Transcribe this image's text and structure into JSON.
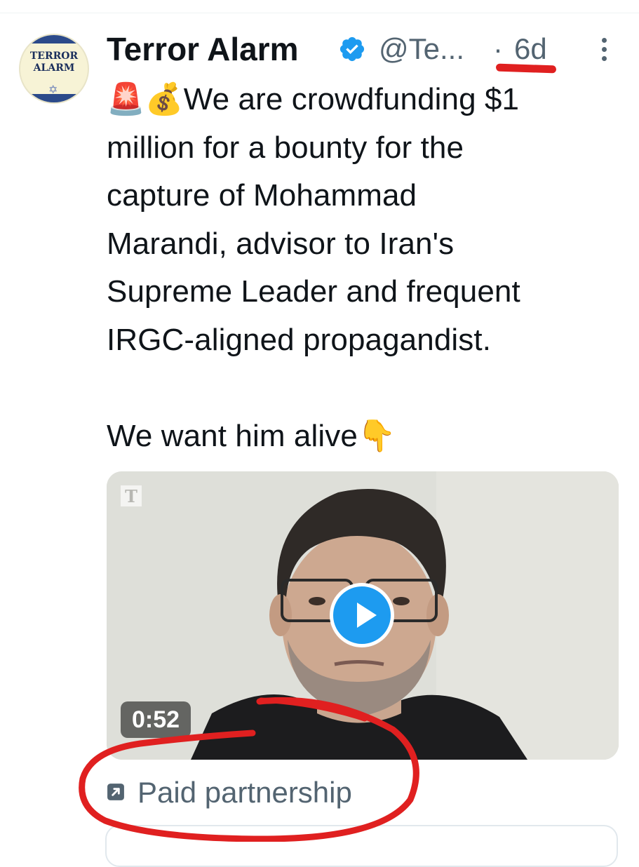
{
  "author": {
    "name": "Terror Alarm",
    "handle": "@Te...",
    "separator": "·",
    "time": "6d",
    "avatar_text_line1": "TERROR",
    "avatar_text_line2": "ALARM",
    "verified_icon": "verified-badge-icon",
    "more_icon": "more-vertical-icon"
  },
  "tweet": {
    "emoji_1": "🚨",
    "emoji_2": "💰",
    "text_main": "We are crowdfunding $1\nmillion for a bounty for the\ncapture of Mohammad\nMarandi, advisor to Iran's\nSupreme Leader and frequent\nIRGC-aligned propagandist.\n\nWe want him alive",
    "emoji_3": "👇"
  },
  "media": {
    "watermark": "T",
    "duration": "0:52",
    "play_icon": "play-icon"
  },
  "paid_partnership": {
    "label": "Paid partnership",
    "icon": "external-arrow-icon"
  },
  "colors": {
    "accent": "#1d9bf0",
    "secondary_text": "#536471",
    "annotation_red": "#e02020"
  }
}
